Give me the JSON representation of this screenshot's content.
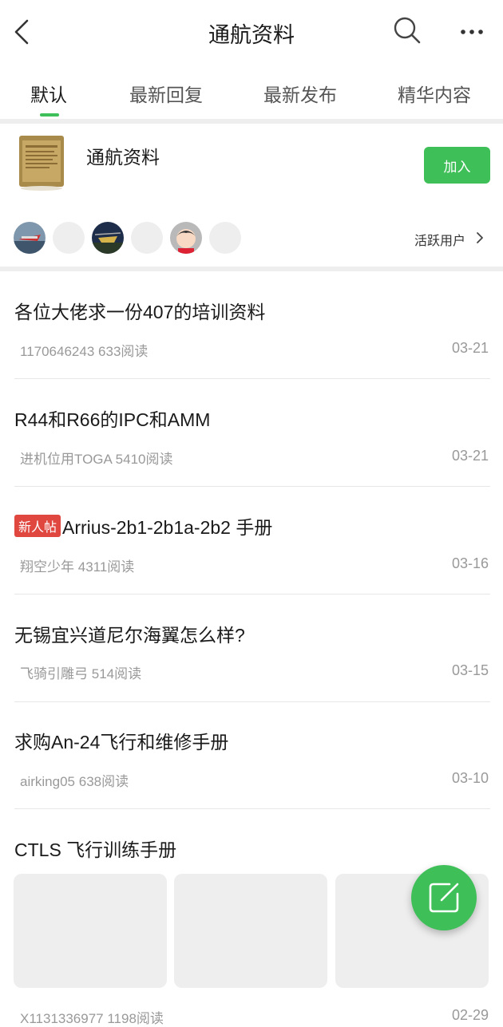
{
  "header": {
    "title": "通航资料"
  },
  "tabs": [
    {
      "label": "默认",
      "active": true
    },
    {
      "label": "最新回复",
      "active": false
    },
    {
      "label": "最新发布",
      "active": false
    },
    {
      "label": "精华内容",
      "active": false
    }
  ],
  "group": {
    "name": "通航资料",
    "join_label": "加入",
    "active_users_label": "活跃用户"
  },
  "posts": [
    {
      "title": "各位大佬求一份407的培训资料",
      "author": "1170646243",
      "reads": "633阅读",
      "date": "03-21"
    },
    {
      "title": "R44和R66的IPC和AMM",
      "author": "进机位用TOGA",
      "reads": "5410阅读",
      "date": "03-21"
    },
    {
      "badge": "新人帖",
      "title": "Arrius-2b1-2b1a-2b2 手册",
      "author": "翔空少年",
      "reads": "4311阅读",
      "date": "03-16"
    },
    {
      "title": "无锡宜兴道尼尔海翼怎么样?",
      "author": "飞骑引雕弓",
      "reads": "514阅读",
      "date": "03-15"
    },
    {
      "title": "求购An-24飞行和维修手册",
      "author": "airking05",
      "reads": "638阅读",
      "date": "03-10"
    },
    {
      "title": "CTLS 飞行训练手册",
      "author": "X1131336977",
      "reads": "1198阅读",
      "date": "02-29"
    }
  ],
  "colors": {
    "accent": "#3fbf58",
    "badge": "#e0473f",
    "meta": "#999999"
  }
}
